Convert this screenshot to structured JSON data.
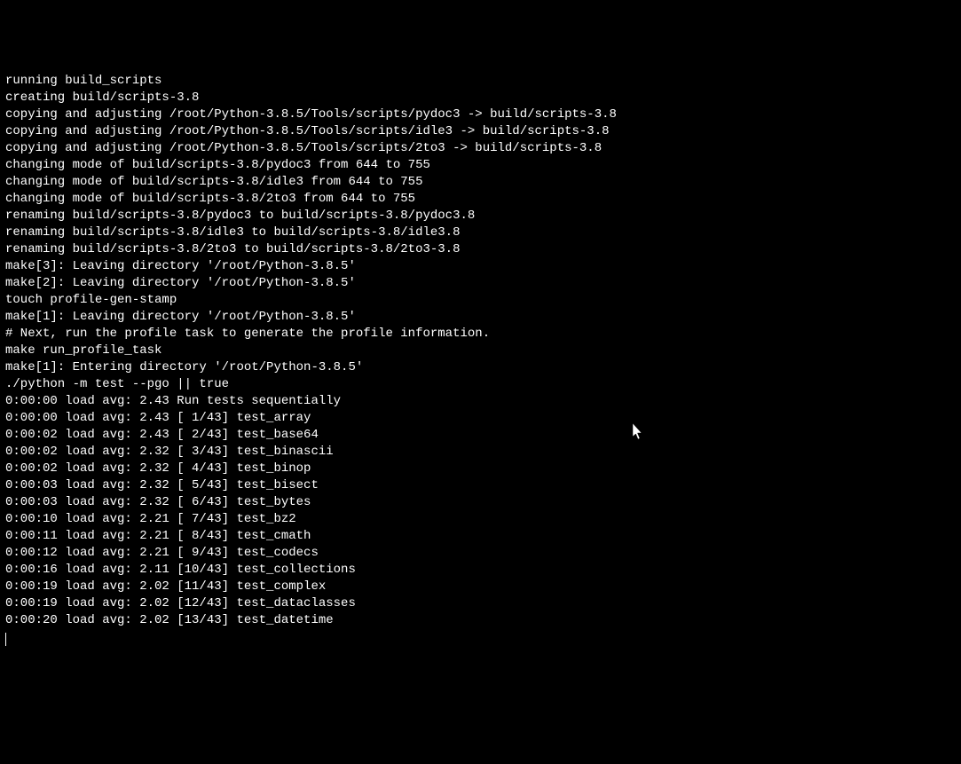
{
  "terminal": {
    "lines": [
      "running build_scripts",
      "creating build/scripts-3.8",
      "copying and adjusting /root/Python-3.8.5/Tools/scripts/pydoc3 -> build/scripts-3.8",
      "copying and adjusting /root/Python-3.8.5/Tools/scripts/idle3 -> build/scripts-3.8",
      "copying and adjusting /root/Python-3.8.5/Tools/scripts/2to3 -> build/scripts-3.8",
      "changing mode of build/scripts-3.8/pydoc3 from 644 to 755",
      "changing mode of build/scripts-3.8/idle3 from 644 to 755",
      "changing mode of build/scripts-3.8/2to3 from 644 to 755",
      "renaming build/scripts-3.8/pydoc3 to build/scripts-3.8/pydoc3.8",
      "renaming build/scripts-3.8/idle3 to build/scripts-3.8/idle3.8",
      "renaming build/scripts-3.8/2to3 to build/scripts-3.8/2to3-3.8",
      "make[3]: Leaving directory '/root/Python-3.8.5'",
      "make[2]: Leaving directory '/root/Python-3.8.5'",
      "touch profile-gen-stamp",
      "make[1]: Leaving directory '/root/Python-3.8.5'",
      "# Next, run the profile task to generate the profile information.",
      "make run_profile_task",
      "make[1]: Entering directory '/root/Python-3.8.5'",
      "./python -m test --pgo || true",
      "0:00:00 load avg: 2.43 Run tests sequentially",
      "0:00:00 load avg: 2.43 [ 1/43] test_array",
      "0:00:02 load avg: 2.43 [ 2/43] test_base64",
      "0:00:02 load avg: 2.32 [ 3/43] test_binascii",
      "0:00:02 load avg: 2.32 [ 4/43] test_binop",
      "0:00:03 load avg: 2.32 [ 5/43] test_bisect",
      "0:00:03 load avg: 2.32 [ 6/43] test_bytes",
      "0:00:10 load avg: 2.21 [ 7/43] test_bz2",
      "0:00:11 load avg: 2.21 [ 8/43] test_cmath",
      "0:00:12 load avg: 2.21 [ 9/43] test_codecs",
      "0:00:16 load avg: 2.11 [10/43] test_collections",
      "0:00:19 load avg: 2.02 [11/43] test_complex",
      "0:00:19 load avg: 2.02 [12/43] test_dataclasses",
      "0:00:20 load avg: 2.02 [13/43] test_datetime"
    ]
  }
}
